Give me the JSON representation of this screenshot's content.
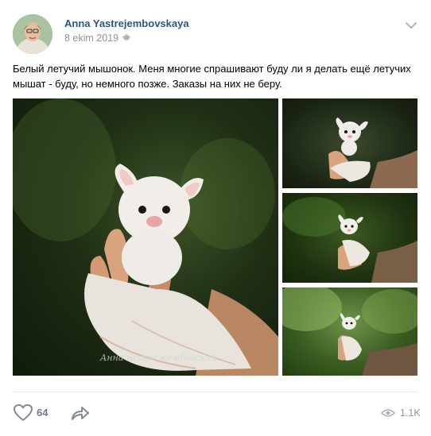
{
  "post": {
    "author": "Anna Yastrejembovskaya",
    "date": "8 ekim 2019",
    "text": "Белый летучий мышонок. Меня многие спрашивают буду ли я делать ещё летучих мышат - буду, но немного позже. Заказы на них не беру.",
    "watermark": "Анна Ястрежембовская",
    "like_count": "64",
    "view_count": "1.1K"
  },
  "colors": {
    "author_link": "#2a5885",
    "meta_gray": "#939393",
    "like_count": "#6f7b8a",
    "divider": "#e7e8ec"
  },
  "icons": {
    "menu": "chevron-down-icon",
    "platform": "android-icon",
    "like": "heart-icon",
    "share": "share-arrow-icon",
    "views": "eye-icon"
  }
}
